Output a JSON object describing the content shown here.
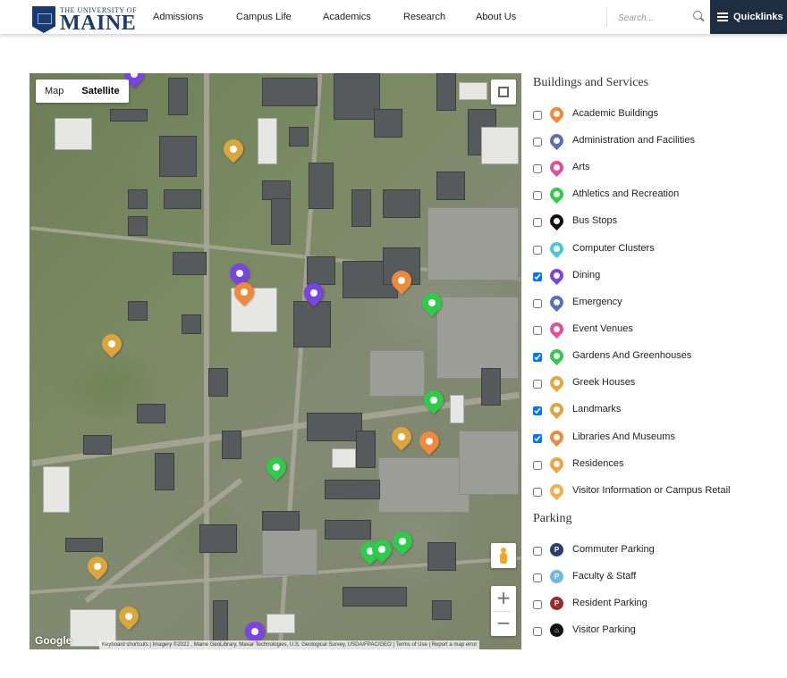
{
  "header": {
    "logo_top": "THE UNIVERSITY OF",
    "logo_main": "MAINE",
    "nav": [
      "Admissions",
      "Campus Life",
      "Academics",
      "Research",
      "About Us"
    ],
    "search_placeholder": "Search...",
    "quicklinks": "Quicklinks"
  },
  "map": {
    "map_label": "Map",
    "satellite_label": "Satellite",
    "selected_type": "Satellite",
    "zoom_in": "+",
    "zoom_out": "−",
    "google": "Google",
    "attribution": "Keyboard shortcuts  |  Imagery ©2022 , Maine GeoLibrary, Maxar Technologies, U.S. Geological Survey, USDA/FPAC/GEO  |  Terms of Use  |  Report a map error"
  },
  "legend": {
    "buildings_heading": "Buildings and Services",
    "parking_heading": "Parking",
    "buildings": [
      {
        "label": "Academic Buildings",
        "checked": false,
        "color": "#f0893b",
        "icon": "academic-icon"
      },
      {
        "label": "Administration and Facilities",
        "checked": false,
        "color": "#5b6fb5",
        "icon": "administration-icon"
      },
      {
        "label": "Arts",
        "checked": false,
        "color": "#e0509a",
        "icon": "arts-icon"
      },
      {
        "label": "Athletics and Recreation",
        "checked": false,
        "color": "#2fce4a",
        "icon": "athletics-icon"
      },
      {
        "label": "Bus Stops",
        "checked": false,
        "color": "#111111",
        "icon": "bus-icon"
      },
      {
        "label": "Computer Clusters",
        "checked": false,
        "color": "#47c9d6",
        "icon": "computer-icon"
      },
      {
        "label": "Dining",
        "checked": true,
        "color": "#7a44e0",
        "icon": "dining-icon"
      },
      {
        "label": "Emergency",
        "checked": false,
        "color": "#5672b8",
        "icon": "emergency-icon"
      },
      {
        "label": "Event Venues",
        "checked": false,
        "color": "#e84f97",
        "icon": "event-icon"
      },
      {
        "label": "Gardens And Greenhouses",
        "checked": true,
        "color": "#2ecc4a",
        "icon": "leaf-icon"
      },
      {
        "label": "Greek Houses",
        "checked": false,
        "color": "#e4a93a",
        "icon": "greek-icon"
      },
      {
        "label": "Landmarks",
        "checked": true,
        "color": "#dda63c",
        "icon": "landmark-icon"
      },
      {
        "label": "Libraries And Museums",
        "checked": true,
        "color": "#f0893b",
        "icon": "library-icon"
      },
      {
        "label": "Residences",
        "checked": false,
        "color": "#f0a440",
        "icon": "residence-icon"
      },
      {
        "label": "Visitor Information or Campus Retail",
        "checked": false,
        "color": "#f0b04a",
        "icon": "visitor-icon"
      }
    ],
    "parking": [
      {
        "label": "Commuter Parking",
        "checked": false,
        "color": "#2a3e6e",
        "glyph": "P"
      },
      {
        "label": "Faculty & Staff",
        "checked": false,
        "color": "#6fb7e8",
        "glyph": "P"
      },
      {
        "label": "Resident Parking",
        "checked": false,
        "color": "#9b2a2a",
        "glyph": "P"
      },
      {
        "label": "Visitor Parking",
        "checked": false,
        "color": "#111111",
        "glyph": "⌂"
      }
    ]
  },
  "markers": [
    {
      "type": "landmark",
      "color": "#dda63c",
      "icon": "landmark-icon"
    },
    {
      "type": "landmark",
      "color": "#dda63c",
      "icon": "landmark-icon"
    },
    {
      "type": "landmark",
      "color": "#dda63c",
      "icon": "landmark-icon"
    },
    {
      "type": "landmark",
      "color": "#dda63c",
      "icon": "landmark-icon"
    },
    {
      "type": "landmark",
      "color": "#dda63c",
      "icon": "landmark-icon"
    },
    {
      "type": "dining",
      "color": "#7a44e0",
      "icon": "dining-icon"
    },
    {
      "type": "dining",
      "color": "#7a44e0",
      "icon": "dining-icon"
    },
    {
      "type": "dining",
      "color": "#7a44e0",
      "icon": "dining-icon"
    },
    {
      "type": "dining",
      "color": "#7a44e0",
      "icon": "dining-icon"
    },
    {
      "type": "library",
      "color": "#f0893b",
      "icon": "library-icon"
    },
    {
      "type": "library",
      "color": "#f0893b",
      "icon": "library-icon"
    },
    {
      "type": "library",
      "color": "#f0893b",
      "icon": "library-icon"
    },
    {
      "type": "garden",
      "color": "#2ecc4a",
      "icon": "leaf-icon"
    },
    {
      "type": "garden",
      "color": "#2ecc4a",
      "icon": "leaf-icon"
    },
    {
      "type": "garden",
      "color": "#2ecc4a",
      "icon": "leaf-icon"
    },
    {
      "type": "garden",
      "color": "#2ecc4a",
      "icon": "leaf-icon"
    },
    {
      "type": "garden",
      "color": "#2ecc4a",
      "icon": "leaf-icon"
    },
    {
      "type": "garden",
      "color": "#2ecc4a",
      "icon": "leaf-icon"
    }
  ]
}
